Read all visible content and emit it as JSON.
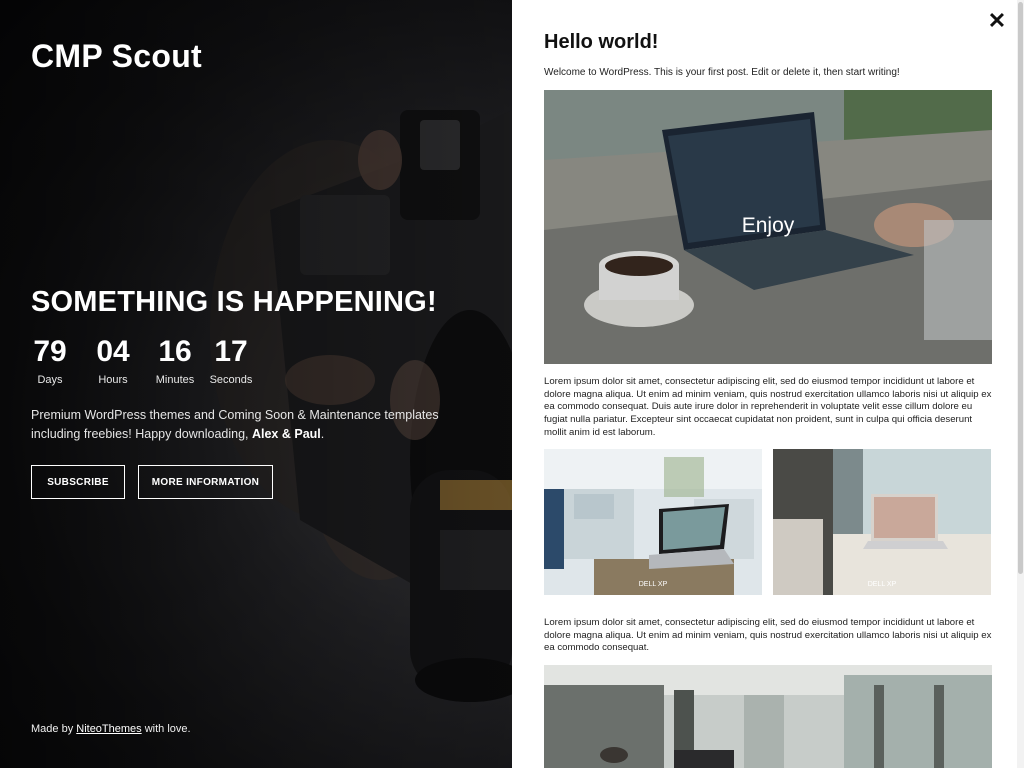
{
  "hero": {
    "brand": "CMP Scout",
    "headline": "SOMETHING IS HAPPENING!",
    "countdown": [
      {
        "value": "79",
        "label": "Days"
      },
      {
        "value": "04",
        "label": "Hours"
      },
      {
        "value": "16",
        "label": "Minutes"
      },
      {
        "value": "17",
        "label": "Seconds"
      }
    ],
    "description_text": "Premium WordPress themes and Coming Soon & Maintenance templates including freebies! Happy downloading, ",
    "description_bold": "Alex & Paul",
    "description_end": ".",
    "subscribe_label": "SUBSCRIBE",
    "more_label": "MORE INFORMATION",
    "footer_prefix": "Made by ",
    "footer_link": "NiteoThemes",
    "footer_suffix": " with love."
  },
  "panel": {
    "close_icon": "close-icon",
    "title": "Hello world!",
    "intro": "Welcome to WordPress. This is your first post. Edit or delete it, then start writing!",
    "main_image_caption": "Enjoy",
    "paragraph1": "Lorem ipsum dolor sit amet, consectetur adipiscing elit, sed do eiusmod tempor incididunt ut labore et dolore magna aliqua. Ut enim ad minim veniam, quis nostrud exercitation ullamco laboris nisi ut aliquip ex ea commodo consequat. Duis aute irure dolor in reprehenderit in voluptate velit esse cillum dolore eu fugiat nulla pariatur. Excepteur sint occaecat cupidatat non proident, sunt in culpa qui officia deserunt mollit anim id est laborum.",
    "gallery": [
      {
        "caption": "DELL XP"
      },
      {
        "caption": "DELL XP"
      }
    ],
    "paragraph2": "Lorem ipsum dolor sit amet, consectetur adipiscing elit, sed do eiusmod tempor incididunt ut labore et dolore magna aliqua. Ut enim ad minim veniam, quis nostrud exercitation ullamco laboris nisi ut aliquip ex ea commodo consequat."
  },
  "colors": {
    "panel_bg": "#ffffff",
    "hero_text": "#ffffff",
    "body_text": "#222222"
  }
}
